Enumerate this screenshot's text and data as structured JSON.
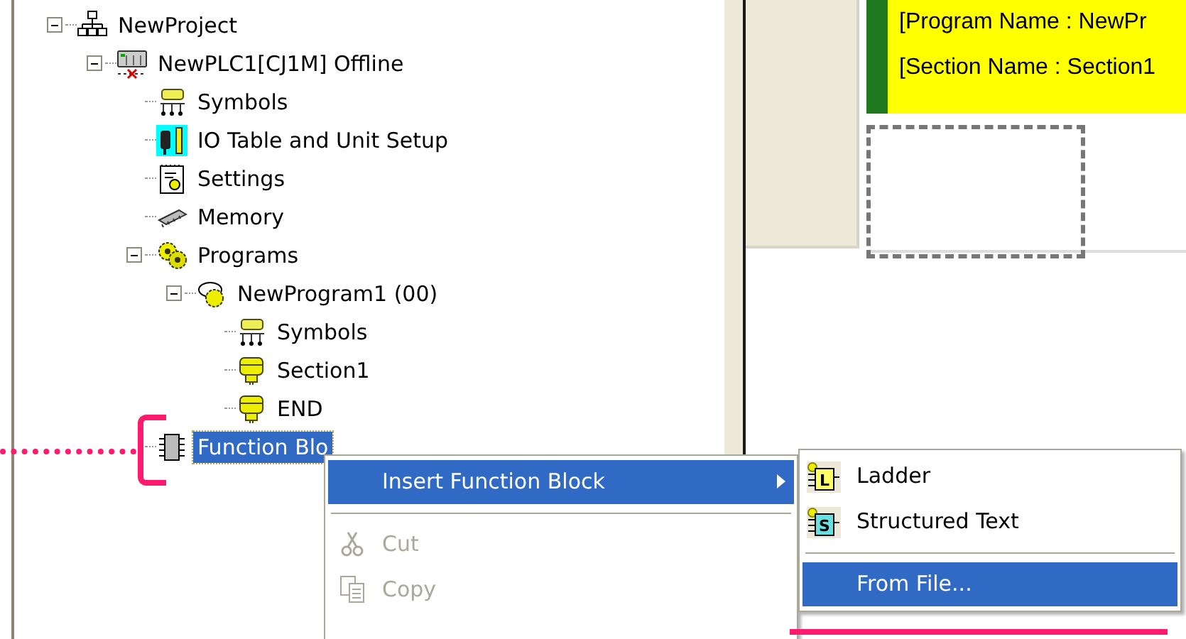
{
  "tree": [
    {
      "kind": "project",
      "label": "NewProject",
      "expanded": true,
      "selected": false,
      "children": [
        {
          "kind": "plc",
          "label": "NewPLC1[CJ1M] Offline",
          "expanded": true,
          "selected": false,
          "children": [
            {
              "kind": "symbols",
              "label": "Symbols",
              "selected": false
            },
            {
              "kind": "io-table",
              "label": "IO Table and Unit Setup",
              "selected": false
            },
            {
              "kind": "settings",
              "label": "Settings",
              "selected": false
            },
            {
              "kind": "memory",
              "label": "Memory",
              "selected": false
            },
            {
              "kind": "programs",
              "label": "Programs",
              "expanded": true,
              "selected": false,
              "children": [
                {
                  "kind": "program",
                  "label": "NewProgram1 (00)",
                  "expanded": true,
                  "selected": false,
                  "children": [
                    {
                      "kind": "symbols",
                      "label": "Symbols",
                      "selected": false
                    },
                    {
                      "kind": "section",
                      "label": "Section1",
                      "selected": false
                    },
                    {
                      "kind": "section",
                      "label": "END",
                      "selected": false
                    }
                  ]
                }
              ]
            },
            {
              "kind": "function-blocks",
              "label": "Function Blo",
              "selected": true
            }
          ]
        }
      ]
    }
  ],
  "editor": {
    "header_lines": [
      "[Program Name : NewPr",
      "[Section Name : Section1"
    ]
  },
  "context_menu": {
    "items": [
      {
        "kind": "submenu",
        "label": "Insert Function Block",
        "selected": true,
        "disabled": false
      },
      {
        "kind": "separator"
      },
      {
        "kind": "cut",
        "label": "Cut",
        "selected": false,
        "disabled": true
      },
      {
        "kind": "copy",
        "label": "Copy",
        "selected": false,
        "disabled": true
      }
    ]
  },
  "submenu": {
    "items": [
      {
        "kind": "ladder",
        "badge": "L",
        "label": "Ladder",
        "selected": false
      },
      {
        "kind": "structured-text",
        "badge": "S",
        "label": "Structured Text",
        "selected": false
      },
      {
        "kind": "separator"
      },
      {
        "kind": "plain",
        "label": "From File...",
        "selected": true
      }
    ]
  }
}
